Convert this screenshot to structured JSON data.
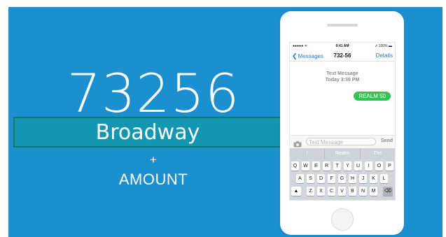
{
  "slide": {
    "short_code": "73256",
    "keyword": "Broadway",
    "plus": "+",
    "amount": "AMOUNT"
  },
  "phone": {
    "status": {
      "left": "●●●●● ᯤ",
      "time": "9:41 AM",
      "right": "➚ 100% ▬"
    },
    "nav": {
      "back_label": "Messages",
      "title": "732-56",
      "details_label": "Details"
    },
    "thread_header": {
      "line1": "Text Message",
      "line2": "Today 3:39 PM"
    },
    "message": {
      "text": "REALM 50"
    },
    "input": {
      "placeholder": "Text Message",
      "send_label": "Send"
    },
    "suggestions": [
      "I",
      "Realm",
      "The"
    ],
    "keyboard": {
      "row1": [
        "Q",
        "W",
        "E",
        "R",
        "T",
        "Y",
        "U",
        "I",
        "O",
        "P"
      ],
      "row2": [
        "A",
        "S",
        "D",
        "F",
        "G",
        "H",
        "J",
        "K",
        "L"
      ],
      "row3": [
        "Z",
        "X",
        "C",
        "V",
        "B",
        "N",
        "M"
      ]
    }
  },
  "colors": {
    "background": "#1b8fd0",
    "keyword_box": "#1296b4",
    "bubble": "#2fc653",
    "link": "#1f7ce8"
  }
}
